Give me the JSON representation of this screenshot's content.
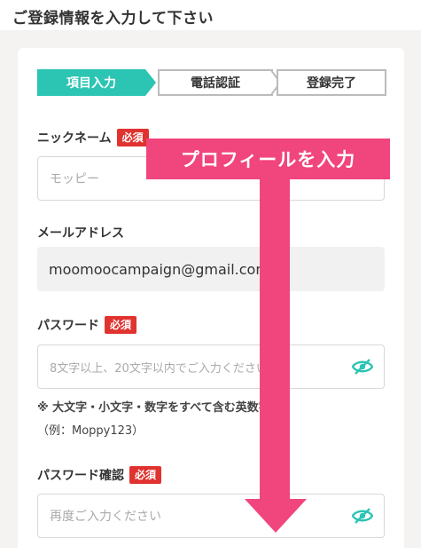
{
  "header": {
    "title": "ご登録情報を入力して下さい"
  },
  "stepper": {
    "steps": [
      {
        "label": "項目入力",
        "state": "active"
      },
      {
        "label": "電話認証",
        "state": "inactive"
      },
      {
        "label": "登録完了",
        "state": "inactive"
      }
    ]
  },
  "form": {
    "nickname": {
      "label": "ニックネーム",
      "badge": "必須",
      "placeholder": "モッピー"
    },
    "email": {
      "label": "メールアドレス",
      "value": "moomoocampaign@gmail.com"
    },
    "password": {
      "label": "パスワード",
      "badge": "必須",
      "placeholder": "8文字以上、20文字以内でご入力ください",
      "note_line1": "※ 大文字・小文字・数字をすべて含む英数字",
      "note_line2": "（例：Moppy123）"
    },
    "password_confirm": {
      "label": "パスワード確認",
      "badge": "必須",
      "placeholder": "再度ご入力ください"
    }
  },
  "annotation": {
    "banner_text": "プロフィールを入力"
  },
  "colors": {
    "accent_teal": "#2cc4b3",
    "required_red": "#e0322f",
    "annotation_pink": "#f1457e"
  },
  "icons": [
    "eye-slash-icon"
  ]
}
